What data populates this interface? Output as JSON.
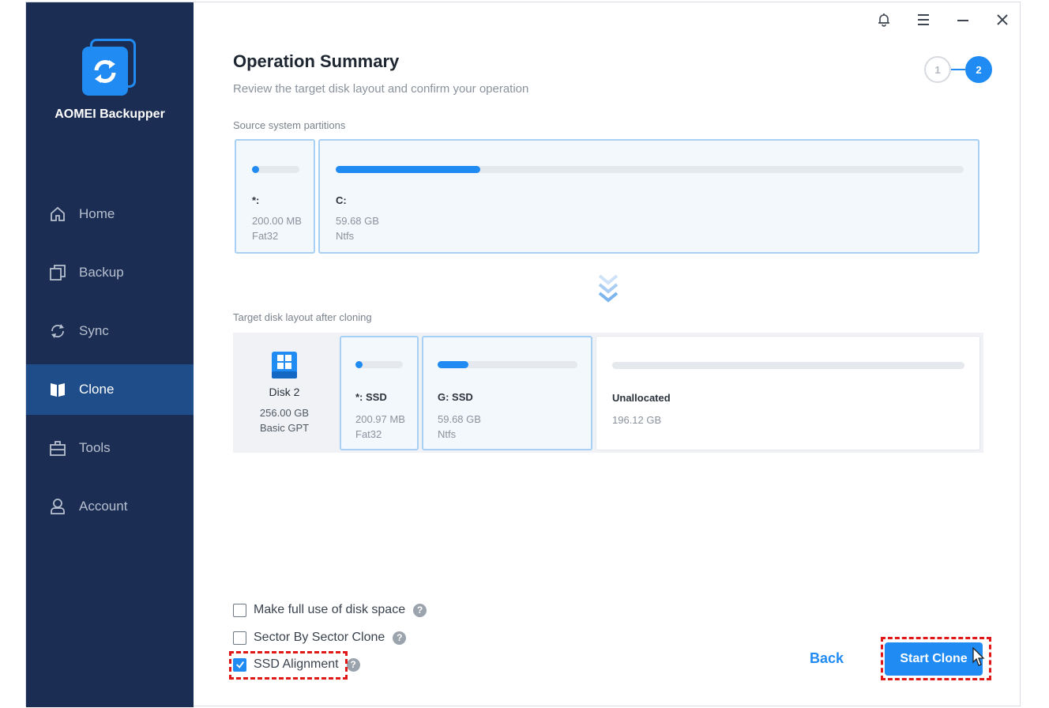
{
  "app": {
    "name": "AOMEI Backupper",
    "brand_color": "#1f8bf3",
    "sidebar_color": "#1b2d52"
  },
  "sidebar": {
    "items": [
      {
        "label": "Home",
        "icon": "home-icon",
        "active": false
      },
      {
        "label": "Backup",
        "icon": "backup-icon",
        "active": false
      },
      {
        "label": "Sync",
        "icon": "sync-icon",
        "active": false
      },
      {
        "label": "Clone",
        "icon": "clone-icon",
        "active": true
      },
      {
        "label": "Tools",
        "icon": "tools-icon",
        "active": false
      },
      {
        "label": "Account",
        "icon": "account-icon",
        "active": false
      }
    ]
  },
  "titlebar": {
    "icons": [
      "bell-icon",
      "menu-icon",
      "minimize-icon",
      "close-icon"
    ]
  },
  "header": {
    "title": "Operation Summary",
    "subtitle": "Review the target disk layout and confirm your operation",
    "steps": [
      "1",
      "2"
    ],
    "current_step": 2
  },
  "source": {
    "label": "Source system partitions",
    "partitions": [
      {
        "name": "*:",
        "size": "200.00 MB",
        "fs": "Fat32",
        "used_fraction": 0.1
      },
      {
        "name": "C:",
        "size": "59.68 GB",
        "fs": "Ntfs",
        "used_fraction": 0.23
      }
    ]
  },
  "target": {
    "label": "Target disk layout after cloning",
    "disk": {
      "name": "Disk 2",
      "size": "256.00 GB",
      "type": "Basic GPT"
    },
    "partitions": [
      {
        "name": "*: SSD",
        "size": "200.97 MB",
        "fs": "Fat32",
        "used_fraction": 0.1
      },
      {
        "name": "G: SSD",
        "size": "59.68 GB",
        "fs": "Ntfs",
        "used_fraction": 0.22
      },
      {
        "name": "Unallocated",
        "size": "196.12 GB",
        "fs": "",
        "used_fraction": 0
      }
    ]
  },
  "options": [
    {
      "label": "Make full use of disk space",
      "checked": false
    },
    {
      "label": "Sector By Sector Clone",
      "checked": false
    },
    {
      "label": "SSD Alignment",
      "checked": true
    }
  ],
  "buttons": {
    "back": "Back",
    "start": "Start Clone"
  }
}
